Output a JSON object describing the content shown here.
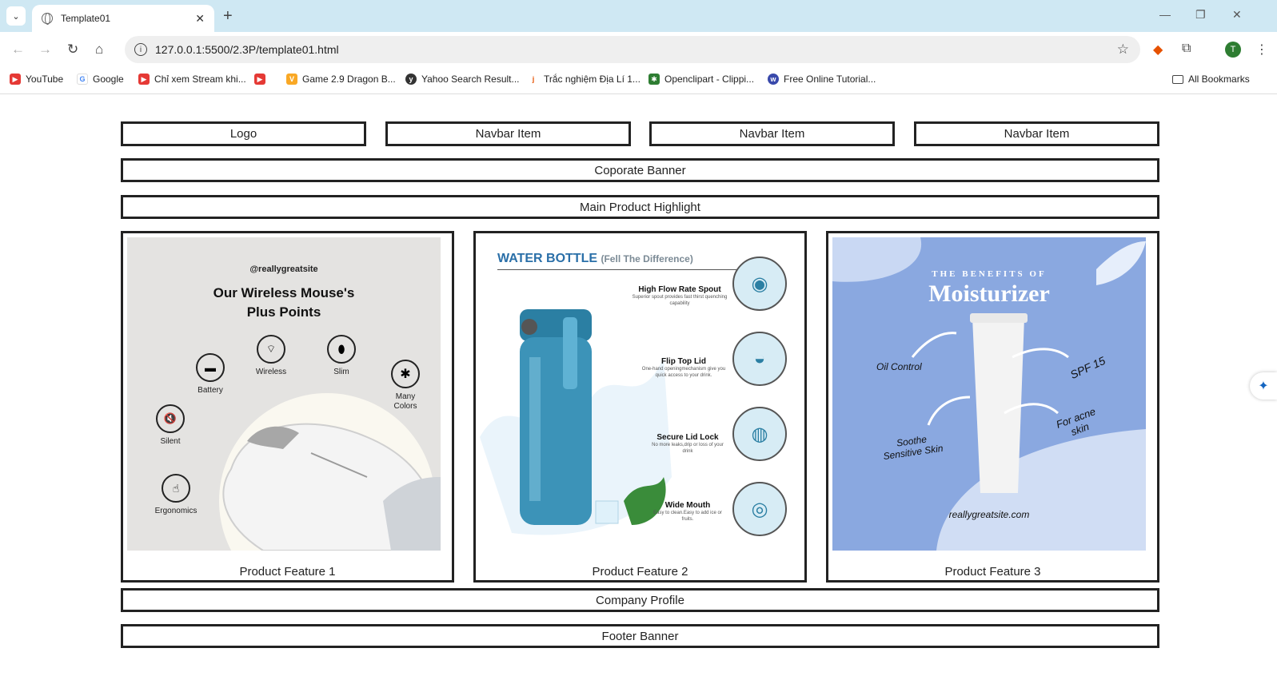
{
  "browser": {
    "tab_title": "Template01",
    "url": "127.0.0.1:5500/2.3P/template01.html",
    "bookmarks": [
      {
        "label": "YouTube",
        "icon": "youtube-icon",
        "color": "#e53935"
      },
      {
        "label": "Google",
        "icon": "google-icon",
        "color": "#4285f4"
      },
      {
        "label": "Chỉ xem Stream khi...",
        "icon": "youtube-icon",
        "color": "#e53935"
      },
      {
        "label": "",
        "icon": "youtube-icon",
        "color": "#e53935"
      },
      {
        "label": "Game 2.9 Dragon B...",
        "icon": "game-icon",
        "color": "#f9a825"
      },
      {
        "label": "Yahoo Search Result...",
        "icon": "yahoo-icon",
        "color": "#333333"
      },
      {
        "label": "Trắc nghiệm Địa Lí 1...",
        "icon": "j-icon",
        "color": "#e65100"
      },
      {
        "label": "Openclipart - Clippi...",
        "icon": "openclipart-icon",
        "color": "#2e7d32"
      },
      {
        "label": "Free Online Tutorial...",
        "icon": "tutorial-icon",
        "color": "#3949ab"
      }
    ],
    "all_bookmarks": "All Bookmarks",
    "profile_initial": "T"
  },
  "page": {
    "logo": "Logo",
    "navbar_items": [
      "Navbar Item",
      "Navbar Item",
      "Navbar Item"
    ],
    "corporate_banner": "Coporate Banner",
    "main_highlight": "Main Product Highlight",
    "products": [
      {
        "caption": "Product Feature 1",
        "handle": "@reallygreatsite",
        "title_line1": "Our Wireless Mouse's",
        "title_line2": "Plus Points",
        "features": [
          "Battery",
          "Wireless",
          "Slim",
          "Many Colors",
          "Silent",
          "Ergonomics"
        ]
      },
      {
        "caption": "Product Feature 2",
        "title": "WATER BOTTLE",
        "subtitle": "(Fell The Difference)",
        "features": [
          {
            "name": "High Flow Rate Spout",
            "desc": "Superior spout provides fast thirst quenching capability"
          },
          {
            "name": "Flip Top Lid",
            "desc": "One-hand openingmechanism give you quick access to your drink."
          },
          {
            "name": "Secure Lid Lock",
            "desc": "No more leaks,drip or loss of your drink"
          },
          {
            "name": "Wide Mouth",
            "desc": "Easy to clean.Easy to add ice or fruits."
          }
        ]
      },
      {
        "caption": "Product Feature 3",
        "kicker": "THE BENEFITS OF",
        "title": "Moisturizer",
        "benefits": [
          "Oil Control",
          "SPF 15",
          "Soothe Sensitive Skin",
          "For acne skin"
        ],
        "site": "reallygreatsite.com"
      }
    ],
    "company_profile": "Company Profile",
    "footer_banner": "Footer Banner"
  }
}
